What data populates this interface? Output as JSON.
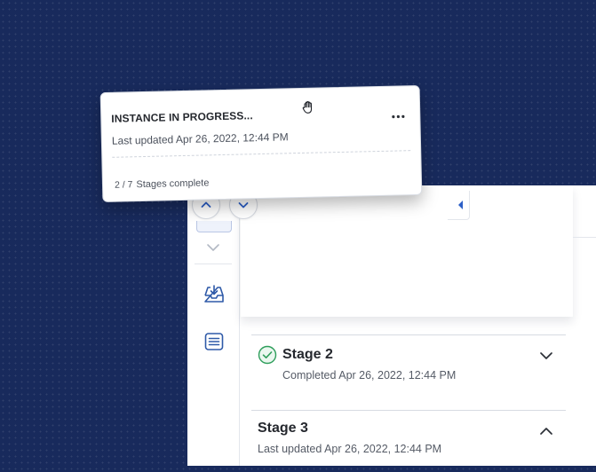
{
  "drag_card": {
    "title": "INSTANCE IN PROGRESS...",
    "last_updated": "Last updated Apr 26, 2022, 12:44 PM",
    "progress_fraction": "2 / 7",
    "progress_label": "Stages complete",
    "more_icon": "more-horizontal-icon",
    "cursor_icon": "grab-hand-icon"
  },
  "rail": {
    "icons": [
      "chevron-down-icon",
      "inbox-download-icon",
      "list-document-icon"
    ]
  },
  "navigation": {
    "up_icon": "chevron-up-icon",
    "down_icon": "chevron-down-icon"
  },
  "stages": [
    {
      "title": "Stage 2",
      "status": "Completed Apr 26, 2022, 12:44 PM",
      "state": "completed",
      "expanded": false
    },
    {
      "title": "Stage 3",
      "status": "Last updated Apr 26, 2022, 12:44 PM",
      "state": "in-progress",
      "expanded": true
    }
  ],
  "colors": {
    "background": "#182a5c",
    "accent": "#2c5fc7",
    "success": "#2e9e5b",
    "icon": "#2f5aa8"
  }
}
